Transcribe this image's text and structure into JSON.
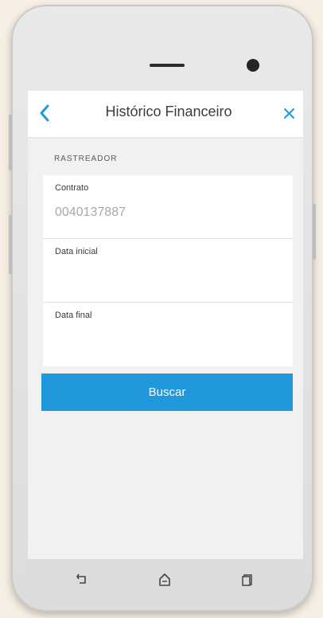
{
  "app": {
    "title": "Histórico Financeiro"
  },
  "section": {
    "label": "RASTREADOR"
  },
  "form": {
    "contract": {
      "label": "Contrato",
      "value": "0040137887"
    },
    "start_date": {
      "label": "Data inicial",
      "value": ""
    },
    "end_date": {
      "label": "Data final",
      "value": ""
    }
  },
  "actions": {
    "search_label": "Buscar"
  },
  "icons": {
    "back": "chevron-left-icon",
    "close": "close-icon",
    "nav_back": "back-arrow-icon",
    "nav_home": "home-icon",
    "nav_recent": "recent-apps-icon"
  },
  "colors": {
    "accent": "#1f98dc",
    "background": "#f1f1f1",
    "text": "#3c3c3c",
    "placeholder": "#a8a8a8"
  }
}
